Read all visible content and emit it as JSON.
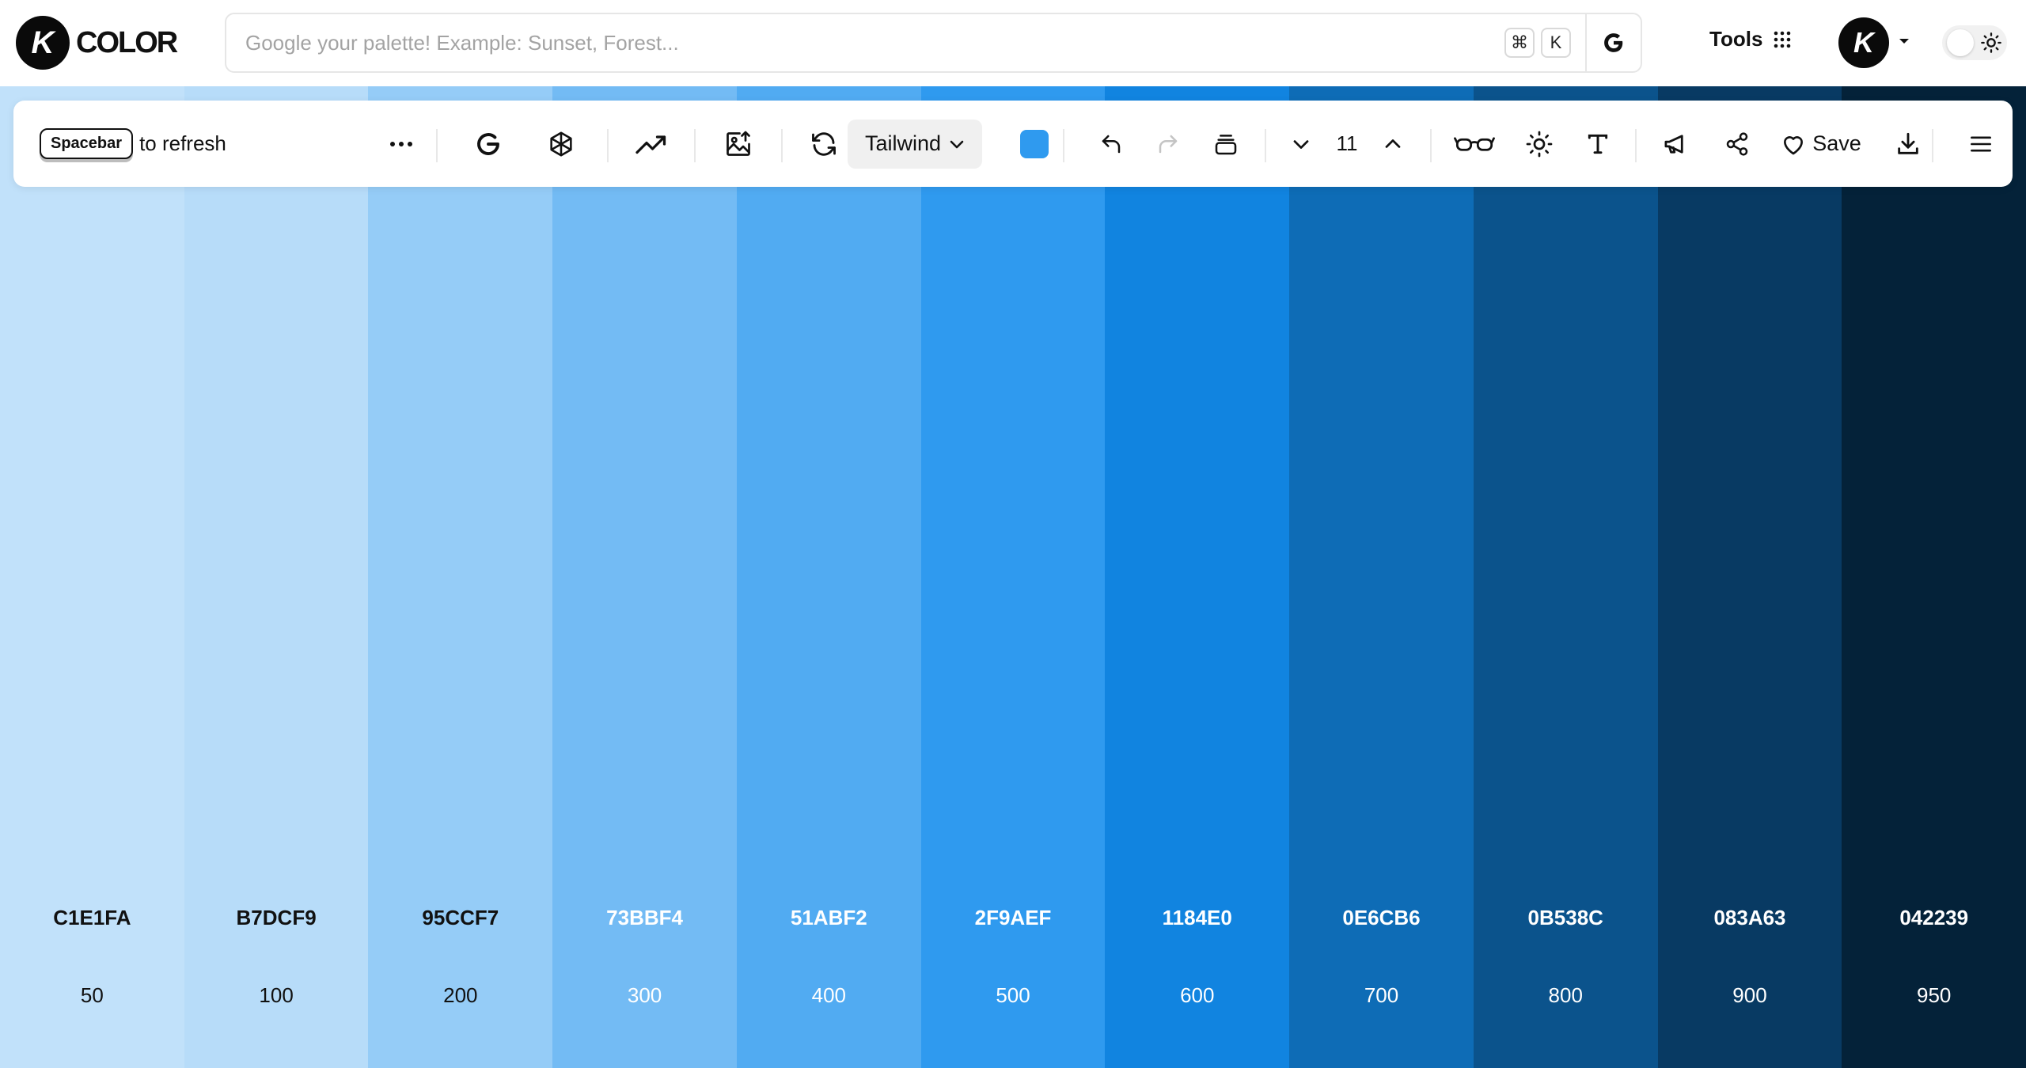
{
  "header": {
    "logo_letter": "K",
    "logo_text": "COLOR",
    "search": {
      "placeholder": "Google your palette! Example: Sunset, Forest...",
      "value": "",
      "shortcut_cmd": "⌘",
      "shortcut_key": "K",
      "google_letter": "G"
    },
    "tools_label": "Tools",
    "avatar_letter": "K"
  },
  "toolbar": {
    "spacebar_key": "Spacebar",
    "refresh_hint": "to refresh",
    "preset_label": "Tailwind",
    "base_color": "#2F9AEF",
    "count": "11",
    "save_label": "Save",
    "icons": [
      "more-icon",
      "google-icon",
      "openai-icon",
      "trend-icon",
      "image-upload-icon",
      "refresh-icon",
      "undo-icon",
      "redo-icon",
      "layers-icon",
      "decrease-icon",
      "increase-icon",
      "glasses-icon",
      "sun-icon",
      "text-icon",
      "megaphone-icon",
      "share-icon",
      "heart-icon",
      "download-icon",
      "menu-icon"
    ]
  },
  "palette": {
    "swatches": [
      {
        "hex": "C1E1FA",
        "shade": "50",
        "color": "#C1E1FA",
        "text": "#111111"
      },
      {
        "hex": "B7DCF9",
        "shade": "100",
        "color": "#B7DCF9",
        "text": "#111111"
      },
      {
        "hex": "95CCF7",
        "shade": "200",
        "color": "#95CCF7",
        "text": "#111111"
      },
      {
        "hex": "73BBF4",
        "shade": "300",
        "color": "#73BBF4",
        "text": "#ffffff"
      },
      {
        "hex": "51ABF2",
        "shade": "400",
        "color": "#51ABF2",
        "text": "#ffffff"
      },
      {
        "hex": "2F9AEF",
        "shade": "500",
        "color": "#2F9AEF",
        "text": "#ffffff"
      },
      {
        "hex": "1184E0",
        "shade": "600",
        "color": "#1184E0",
        "text": "#ffffff"
      },
      {
        "hex": "0E6CB6",
        "shade": "700",
        "color": "#0E6CB6",
        "text": "#ffffff"
      },
      {
        "hex": "0B538C",
        "shade": "800",
        "color": "#0B538C",
        "text": "#ffffff"
      },
      {
        "hex": "083A63",
        "shade": "900",
        "color": "#083A63",
        "text": "#ffffff"
      },
      {
        "hex": "042239",
        "shade": "950",
        "color": "#042239",
        "text": "#ffffff"
      }
    ]
  }
}
